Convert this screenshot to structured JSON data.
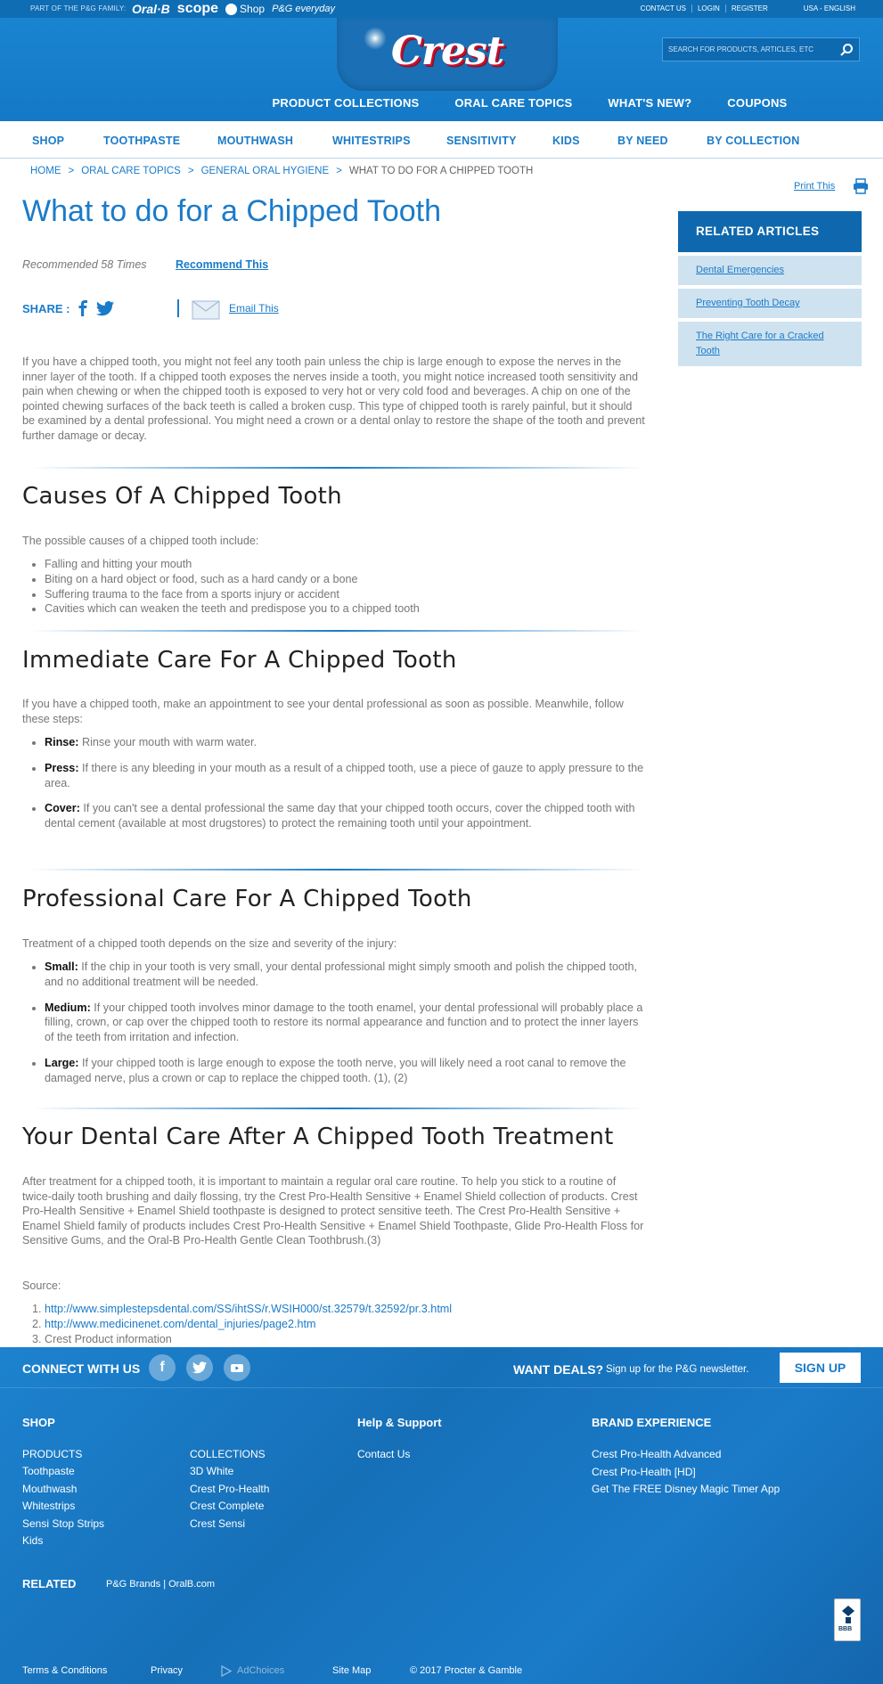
{
  "topbar": {
    "pg_family": "PART OF THE P&G FAMILY:",
    "brands": [
      "Oral·B",
      "scope",
      "Shop",
      "P&G everyday"
    ],
    "links": [
      "CONTACT US",
      "LOGIN",
      "REGISTER"
    ],
    "locale": "USA - ENGLISH"
  },
  "header": {
    "logo": "Crest",
    "search_placeholder": "SEARCH FOR PRODUCTS, ARTICLES, ETC"
  },
  "main_nav": [
    "PRODUCT COLLECTIONS",
    "ORAL CARE TOPICS",
    "WHAT'S NEW?",
    "COUPONS"
  ],
  "sub_nav": [
    "SHOP",
    "TOOTHPASTE",
    "MOUTHWASH",
    "WHITESTRIPS",
    "SENSITIVITY",
    "KIDS",
    "BY NEED",
    "BY COLLECTION"
  ],
  "breadcrumb": [
    "HOME",
    "ORAL CARE TOPICS",
    "GENERAL ORAL HYGIENE",
    "WHAT TO DO FOR A CHIPPED TOOTH"
  ],
  "breadcrumb_sep": ">",
  "print_label": "Print This",
  "article": {
    "title": "What to do for a Chipped Tooth",
    "recommended": "Recommended 58 Times",
    "recommend_link": "Recommend This",
    "share_label": "SHARE :",
    "email_link": "Email This",
    "intro": "If you have a chipped tooth, you might not feel any tooth pain unless the chip is large enough to expose the nerves in the inner layer of the tooth. If a chipped tooth exposes the nerves inside a tooth, you might notice increased tooth sensitivity and pain when chewing or when the chipped tooth is exposed to very hot or very cold food and beverages. A chip on one of the pointed chewing surfaces of the back teeth is called a broken cusp. This type of chipped tooth is rarely painful, but it should be examined by a dental professional. You might need a crown or a dental onlay to restore the shape of the tooth and prevent further damage or decay.",
    "causes": {
      "heading": "Causes Of A Chipped Tooth",
      "intro": "The possible causes of a chipped tooth include:",
      "items": [
        "Falling and hitting your mouth",
        "Biting on a hard object or food, such as a hard candy or a bone",
        "Suffering trauma to the face from a sports injury or accident",
        "Cavities which can weaken the teeth and predispose you to a chipped tooth"
      ]
    },
    "immediate": {
      "heading": "Immediate Care For A Chipped Tooth",
      "intro": "If you have a chipped tooth, make an appointment to see your dental professional as soon as possible. Meanwhile, follow these steps:",
      "steps": [
        {
          "label": "Rinse:",
          "text": " Rinse your mouth with warm water."
        },
        {
          "label": "Press:",
          "text": " If there is any bleeding in your mouth as a result of a chipped tooth, use a piece of gauze to apply pressure to the area."
        },
        {
          "label": "Cover:",
          "text": " If you can't see a dental professional the same day that your chipped tooth occurs, cover the chipped tooth with dental cement (available at most drugstores) to protect the remaining tooth until your appointment."
        }
      ]
    },
    "professional": {
      "heading": "Professional Care For A Chipped Tooth",
      "intro": "Treatment of a chipped tooth depends on the size and severity of the injury:",
      "steps": [
        {
          "label": "Small:",
          "text": " If the chip in your tooth is very small, your dental professional might simply smooth and polish the chipped tooth, and no additional treatment will be needed."
        },
        {
          "label": "Medium:",
          "text": " If your chipped tooth involves minor damage to the tooth enamel, your dental professional will probably place a filling, crown, or cap over the chipped tooth to restore its normal appearance and function and to protect the inner layers of the teeth from irritation and infection."
        },
        {
          "label": "Large:",
          "text": " If your chipped tooth is large enough to expose the tooth nerve, you will likely need a root canal to remove the damaged nerve, plus a crown or cap to replace the chipped tooth. (1), (2)"
        }
      ]
    },
    "after": {
      "heading": "Your Dental Care After A Chipped Tooth Treatment",
      "text": "After treatment for a chipped tooth, it is important to maintain a regular oral care routine. To help you stick to a routine of twice-daily tooth brushing and daily flossing, try the Crest Pro-Health Sensitive + Enamel Shield collection of products. Crest Pro-Health Sensitive + Enamel Shield toothpaste is designed to protect sensitive teeth. The Crest Pro-Health Sensitive + Enamel Shield family of products includes Crest Pro-Health Sensitive + Enamel Shield Toothpaste, Glide Pro-Health Floss for Sensitive Gums, and the Oral-B Pro-Health Gentle Clean Toothbrush.(3)"
    },
    "source_label": "Source:",
    "sources": [
      "http://www.simplestepsdental.com/SS/ihtSS/r.WSIH000/st.32579/t.32592/pr.3.html",
      "http://www.medicinenet.com/dental_injuries/page2.htm",
      "Crest Product information"
    ]
  },
  "related": {
    "heading": "RELATED ARTICLES",
    "items": [
      "Dental Emergencies",
      "Preventing Tooth Decay",
      "The Right Care for a Cracked Tooth"
    ]
  },
  "footer": {
    "connect": "CONNECT WITH US",
    "deals": "WANT DEALS?",
    "deals_sub": "Sign up for the P&G newsletter.",
    "signup": "SIGN UP",
    "shop_heading": "SHOP",
    "products_heading": "PRODUCTS",
    "products": [
      "Toothpaste",
      "Mouthwash",
      "Whitestrips",
      "Sensi Stop Strips",
      "Kids"
    ],
    "collections_heading": "COLLECTIONS",
    "collections": [
      "3D White",
      "Crest Pro-Health",
      "Crest Complete",
      "Crest Sensi"
    ],
    "help_heading": "Help & Support",
    "help": [
      "Contact Us"
    ],
    "brand_heading": "BRAND EXPERIENCE",
    "brand": [
      "Crest Pro-Health Advanced",
      "Crest Pro-Health [HD]",
      "Get The FREE Disney Magic Timer App"
    ],
    "related_heading": "RELATED",
    "related_links": "P&G Brands  |  OralB.com",
    "bbb": "BBB",
    "bottom": [
      "Terms & Conditions",
      "Privacy",
      "AdChoices",
      "Site Map",
      "© 2017 Procter & Gamble"
    ]
  },
  "colors": {
    "brand_blue": "#1a7bc9",
    "nav_blue": "#1479c6",
    "related_bg": "#cfe2f0"
  }
}
